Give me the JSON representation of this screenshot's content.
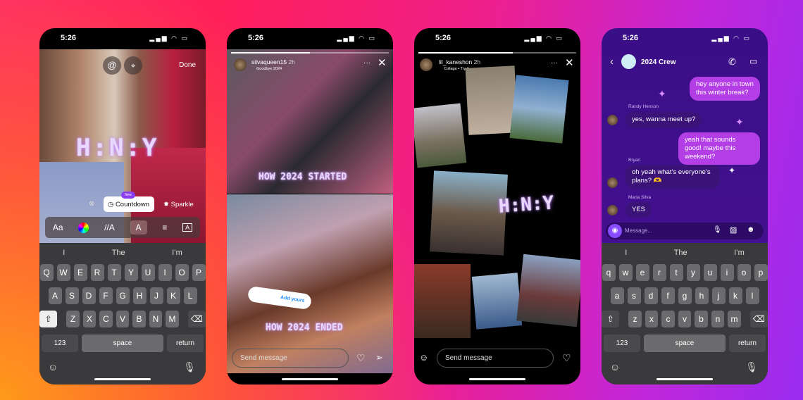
{
  "status": {
    "time": "5:26",
    "icons": "signal wifi battery"
  },
  "keyboard": {
    "suggestions": [
      "I",
      "The",
      "I’m"
    ],
    "upper": [
      [
        "Q",
        "W",
        "E",
        "R",
        "T",
        "Y",
        "U",
        "I",
        "O",
        "P"
      ],
      [
        "A",
        "S",
        "D",
        "F",
        "G",
        "H",
        "J",
        "K",
        "L"
      ],
      [
        "Z",
        "X",
        "C",
        "V",
        "B",
        "N",
        "M"
      ]
    ],
    "lower": [
      [
        "q",
        "w",
        "e",
        "r",
        "t",
        "y",
        "u",
        "i",
        "o",
        "p"
      ],
      [
        "a",
        "s",
        "d",
        "f",
        "g",
        "h",
        "j",
        "k",
        "l"
      ],
      [
        "z",
        "x",
        "c",
        "v",
        "b",
        "n",
        "m"
      ]
    ],
    "numbers": "123",
    "space": "space",
    "return": "return",
    "shift": "⇧",
    "delete": "⌫"
  },
  "editor": {
    "done": "Done",
    "sticker_text": "H:N:Y",
    "new_badge": "New",
    "countdown": "Countdown",
    "sparkle": "Sparkle",
    "tools": [
      "Aa",
      "◉",
      "//A",
      "A",
      "≡",
      "A"
    ]
  },
  "story1": {
    "username": "silvaqueen15",
    "age": "2h",
    "subtitle": "Goodbye 2024",
    "caption_top": "HOW 2024 STARTED",
    "caption_bottom": "HOW 2024 ENDED",
    "add_yours": "Add yours",
    "send_placeholder": "Send message"
  },
  "story2": {
    "username": "lil_kaneshon",
    "age": "2h",
    "subtitle": "Collage • Try it",
    "sticker_text": "H:N:Y",
    "send_placeholder": "Send message"
  },
  "chat": {
    "title": "2024 Crew",
    "input_placeholder": "Message...",
    "messages": [
      {
        "from": "me",
        "text": "hey anyone in town this winter break?"
      },
      {
        "from": "Randy Henson",
        "text": "yes, wanna meet up?"
      },
      {
        "from": "me",
        "text": "yeah that sounds good! maybe this weekend?"
      },
      {
        "from": "Bryan",
        "text": "oh yeah what’s everyone’s plans? 🫶"
      },
      {
        "from": "Maria Silva",
        "text": "YES"
      }
    ]
  },
  "colors": {
    "outgoing": "#b43ee6",
    "incoming": "#3a1278",
    "chat_bg": "#3d0f8a"
  }
}
